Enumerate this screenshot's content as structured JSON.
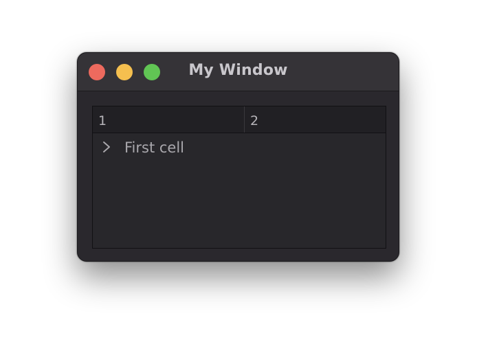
{
  "window": {
    "title": "My Window",
    "controls": {
      "close_color": "#ed6a5e",
      "minimize_color": "#f5bf4f",
      "zoom_color": "#61c554"
    }
  },
  "table": {
    "columns": [
      "1",
      "2"
    ],
    "rows": [
      {
        "expand_icon": "chevron-right-icon",
        "label": "First cell"
      }
    ]
  }
}
